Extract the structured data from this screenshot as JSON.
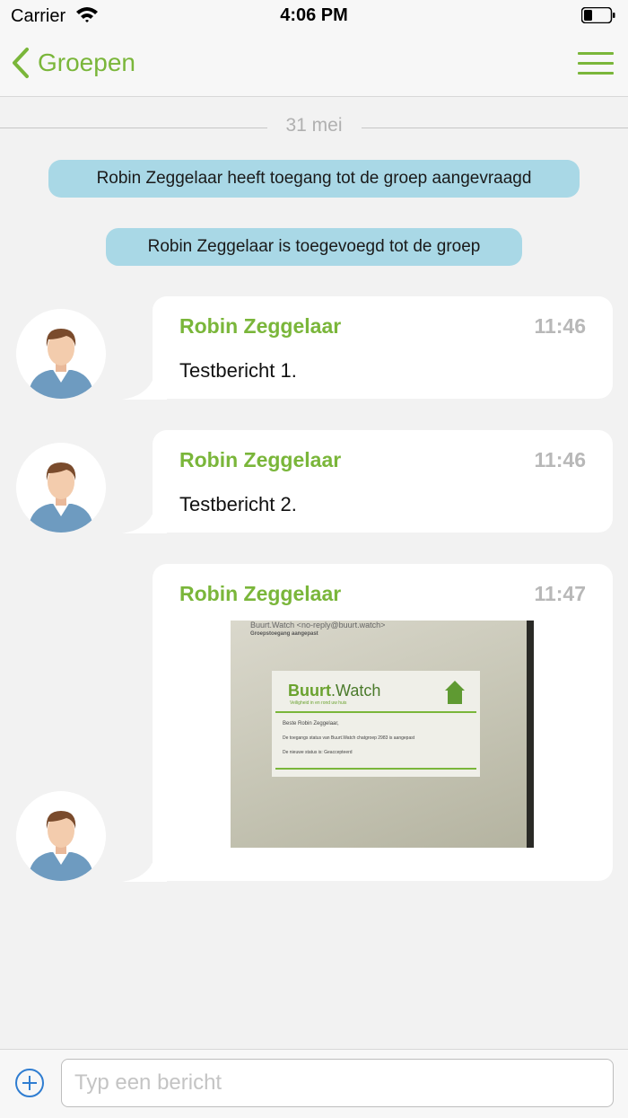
{
  "status_bar": {
    "carrier": "Carrier",
    "time": "4:06 PM"
  },
  "nav": {
    "back_label": "Groepen"
  },
  "date_separator": "31 mei",
  "system_messages": [
    "Robin Zeggelaar heeft toegang tot de groep aangevraagd",
    "Robin Zeggelaar is toegevoegd tot de groep"
  ],
  "messages": [
    {
      "sender": "Robin Zeggelaar",
      "time": "11:46",
      "text": "Testbericht 1."
    },
    {
      "sender": "Robin Zeggelaar",
      "time": "11:46",
      "text": "Testbericht 2."
    },
    {
      "sender": "Robin Zeggelaar",
      "time": "11:47",
      "image": {
        "email_from": "Buurt.Watch <no-reply@buurt.watch>",
        "email_subject": "Groepstoegang aangepast",
        "logo_bold": "Buurt",
        "logo_rest": ".Watch",
        "tagline": "Veiligheid in en rond uw huis",
        "greeting": "Beste Robin Zeggelaar,",
        "line1": "De toegangs status van Buurt.Watch chatgroep 2983 is aangepast",
        "line2": "De nieuwe status is: Geaccepteerd"
      }
    }
  ],
  "composer": {
    "placeholder": "Typ een bericht"
  },
  "colors": {
    "accent": "#7ab63a",
    "system_bubble": "#a9d8e6",
    "background": "#f2f2f2"
  }
}
